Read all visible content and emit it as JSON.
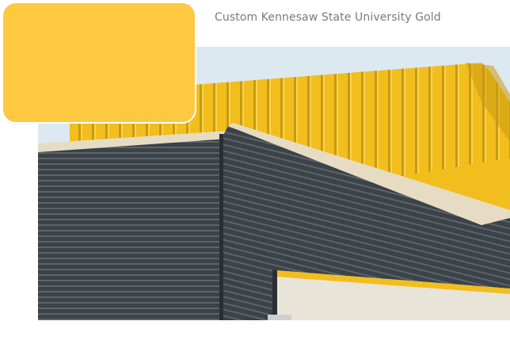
{
  "caption": "Custom Kennesaw State University Gold",
  "swatch_color": "#FEC941",
  "photo": {
    "sky_color": "#DDE9F1",
    "gold_panel_color": "#F2BE1E",
    "gold_shadow_color": "#C99A12",
    "dark_siding_color": "#3B4248",
    "dark_siding_highlight": "#5C656C",
    "cream_trim_color": "#E6DCC4"
  }
}
